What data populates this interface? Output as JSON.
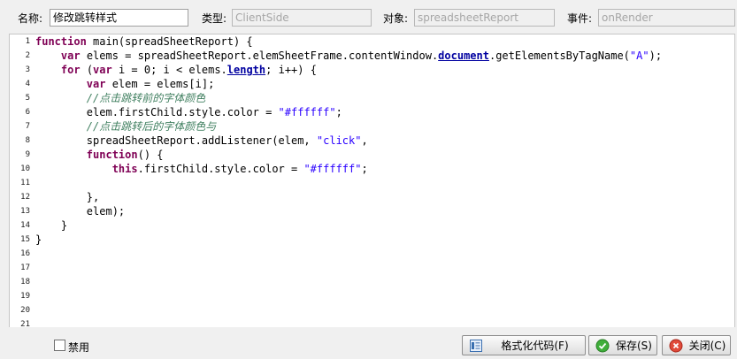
{
  "header": {
    "name_label": "名称:",
    "name_value": "修改跳转样式",
    "type_label": "类型:",
    "type_value": "ClientSide",
    "object_label": "对象:",
    "object_value": "spreadsheetReport",
    "event_label": "事件:",
    "event_value": "onRender"
  },
  "editor": {
    "line_numbers": [
      "1",
      "2",
      "3",
      "4",
      "5",
      "6",
      "7",
      "8",
      "9",
      "10",
      "11",
      "12",
      "13",
      "14",
      "15",
      "16",
      "17",
      "18",
      "19",
      "20",
      "21"
    ],
    "code": {
      "l1": [
        "function",
        " main(spreadSheetReport) {"
      ],
      "l2": [
        "    ",
        "var",
        " elems = spreadSheetReport.elemSheetFrame.contentWindow.",
        "document",
        ".getElementsByTagName(",
        "\"A\"",
        ");"
      ],
      "l3": [
        "    ",
        "for",
        " (",
        "var",
        " i = 0; i < elems.",
        "length",
        "; i++) {"
      ],
      "l4": [
        "        ",
        "var",
        " elem = elems[i];"
      ],
      "l5": [
        "        ",
        "//点击跳转前的字体颜色"
      ],
      "l6": [
        "        elem.firstChild.style.color = ",
        "\"#ffffff\"",
        ";"
      ],
      "l7": [
        "        ",
        "//点击跳转后的字体颜色与"
      ],
      "l8": [
        "        spreadSheetReport.addListener(elem, ",
        "\"click\"",
        ","
      ],
      "l9": [
        "        ",
        "function",
        "() {"
      ],
      "l10": [
        "            ",
        "this",
        ".firstChild.style.color = ",
        "\"#ffffff\"",
        ";"
      ],
      "l12": [
        "        },"
      ],
      "l13": [
        "        elem);"
      ],
      "l14": [
        "    }"
      ],
      "l15": [
        "}"
      ]
    }
  },
  "footer": {
    "disable_label": "禁用",
    "disabled_checked": false,
    "format_label": "格式化代码(F)",
    "save_label": "保存(S)",
    "close_label": "关闭(C)"
  },
  "colors": {
    "keyword": "#7f0055",
    "string": "#2a00ff",
    "comment": "#3f7f5f",
    "variable": "#0b0080"
  }
}
